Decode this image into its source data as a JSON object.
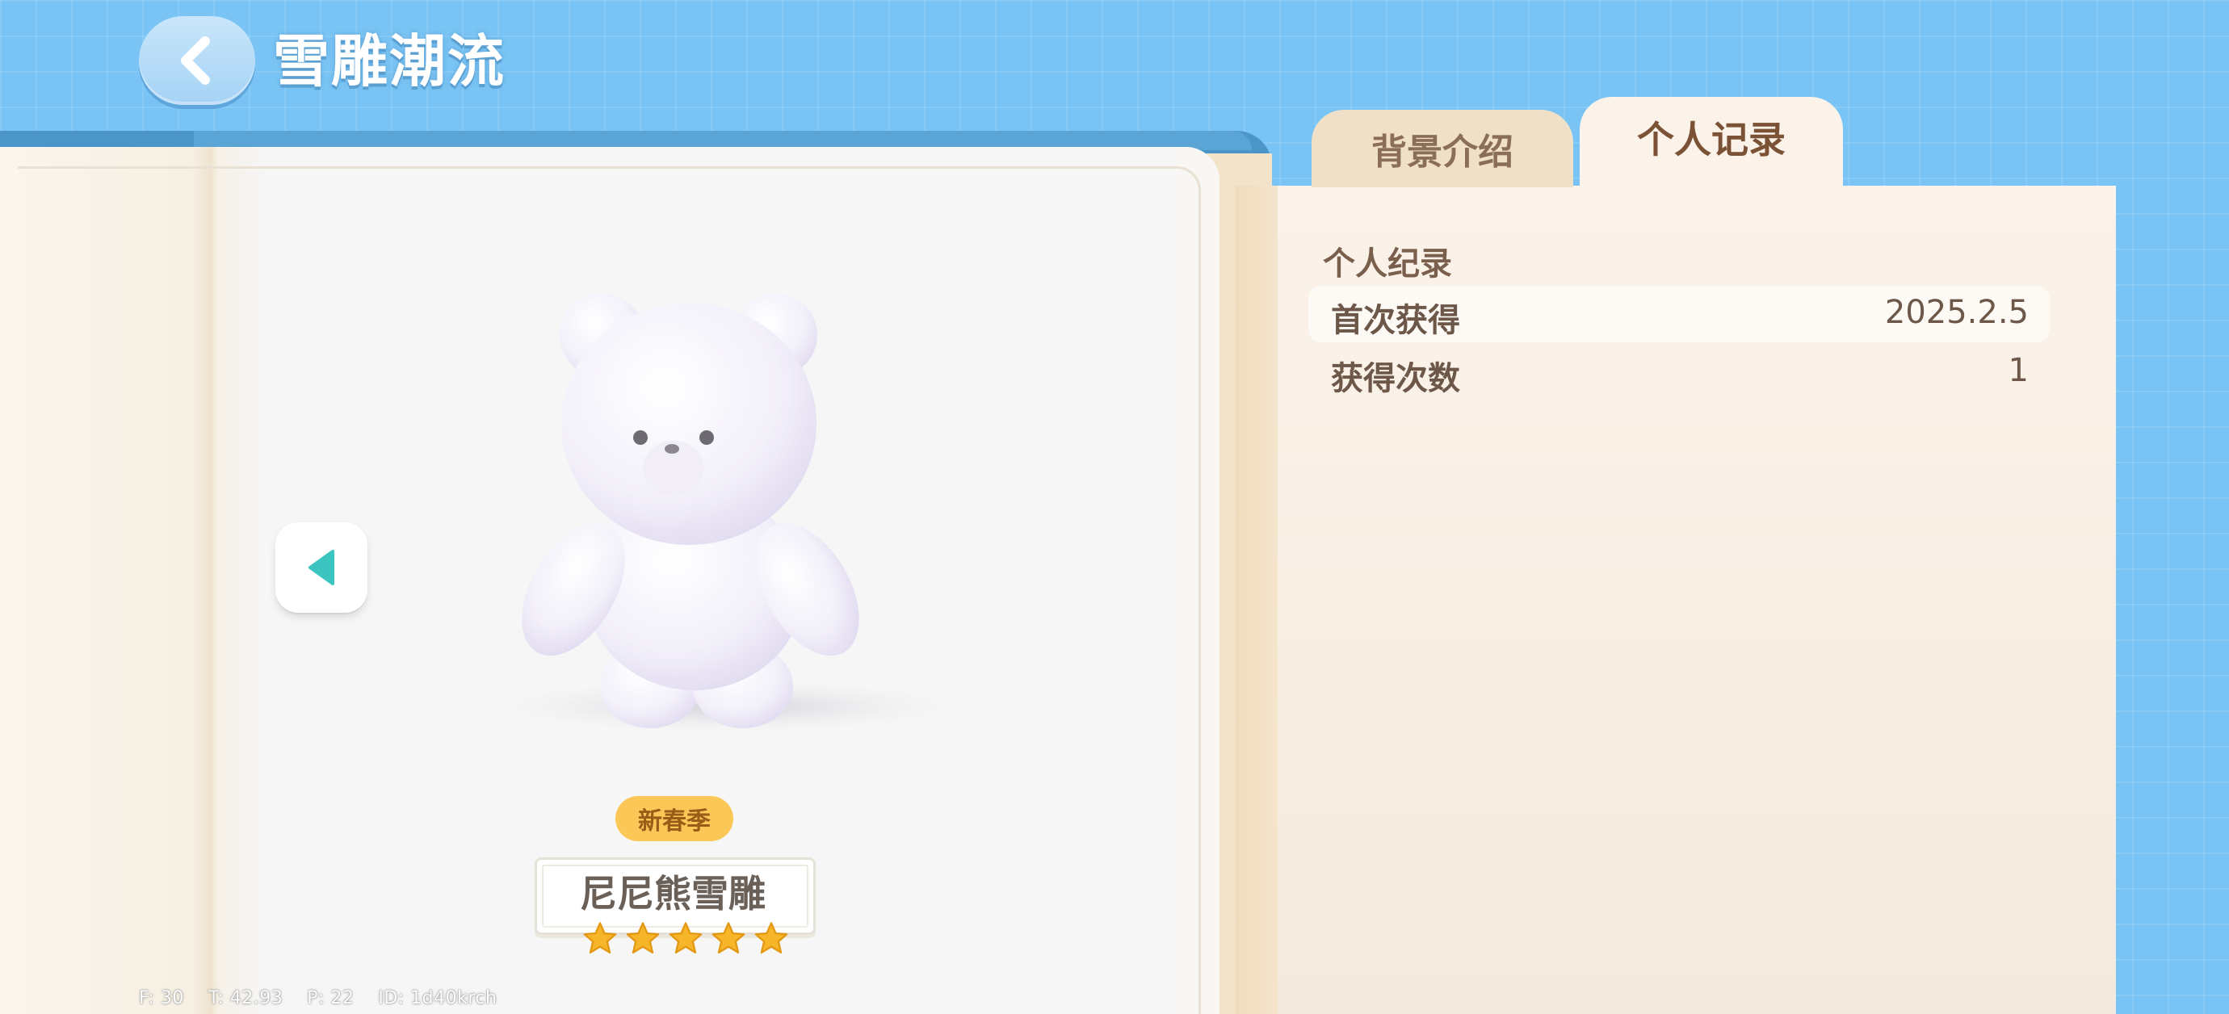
{
  "header": {
    "back_icon": "chevron-left-icon",
    "title": "雪雕潮流"
  },
  "item": {
    "season_badge": "新春季",
    "name": "尼尼熊雪雕",
    "stars": 5,
    "image": "white-snow-bear-sculpture"
  },
  "nav": {
    "prev_icon": "triangle-left-icon",
    "prev_color": "#3cc4c0"
  },
  "tabs": [
    {
      "label": "背景介绍",
      "active": false
    },
    {
      "label": "个人记录",
      "active": true
    }
  ],
  "record": {
    "heading": "个人纪录",
    "rows": [
      {
        "label": "首次获得",
        "value": "2025.2.5"
      },
      {
        "label": "获得次数",
        "value": "1"
      }
    ]
  },
  "debug": "F: 30    T: 42.93    P: 22    ID: 1d40krch",
  "colors": {
    "sky": "#79c4f4",
    "book_cover": "#4b95c9",
    "badge": "#fbc857",
    "star": "#f7b52a",
    "active_tab_text": "#7b5235"
  }
}
